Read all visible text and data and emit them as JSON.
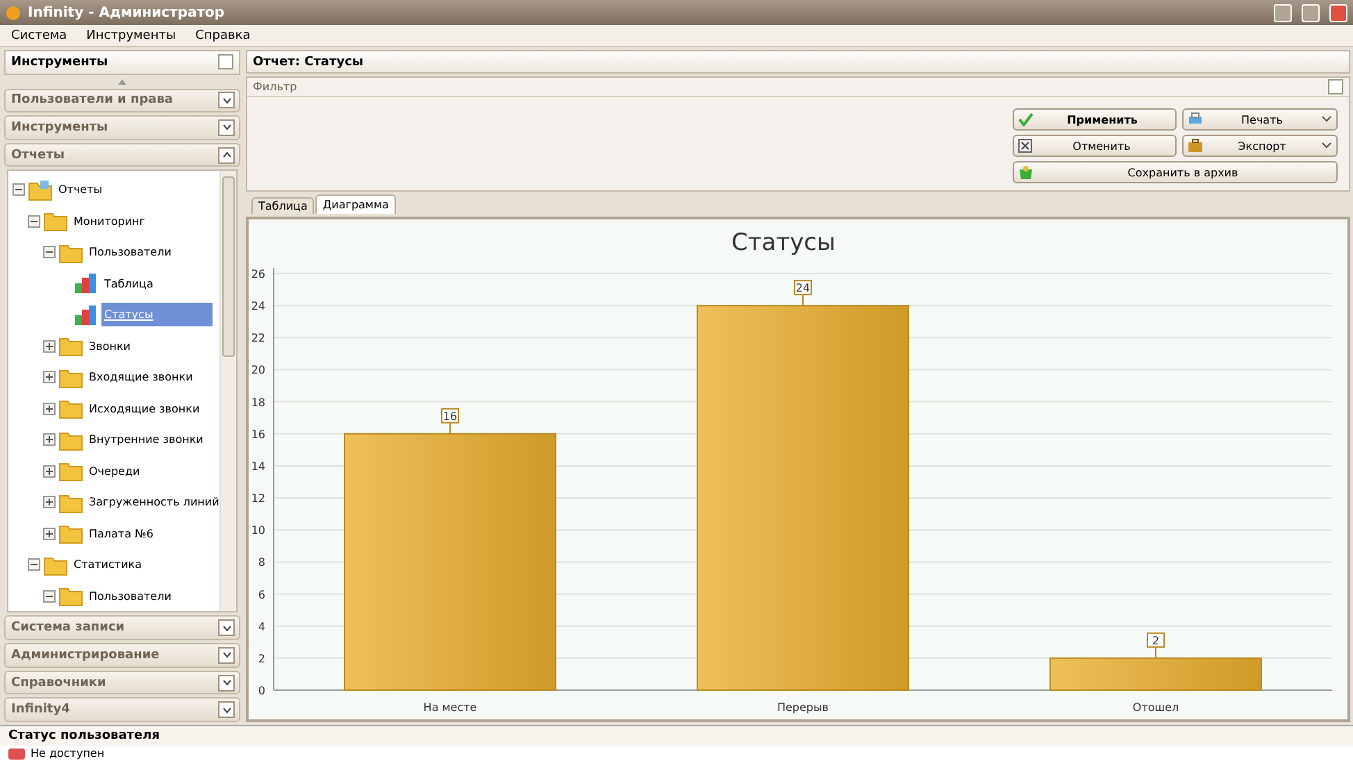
{
  "window": {
    "title": "Infinity - Администратор"
  },
  "menu": [
    "Система",
    "Инструменты",
    "Справка"
  ],
  "tools_panel": {
    "title": "Инструменты",
    "groups_top": [
      {
        "label": "Пользователи и права",
        "expanded": false
      },
      {
        "label": "Инструменты",
        "expanded": false
      },
      {
        "label": "Отчеты",
        "expanded": true
      }
    ],
    "tree": [
      {
        "label": "Отчеты",
        "kind": "root",
        "expanded": true,
        "selected": false,
        "children": [
          {
            "label": "Мониторинг",
            "kind": "folder",
            "expanded": true,
            "selected": false,
            "children": [
              {
                "label": "Пользователи",
                "kind": "folder",
                "expanded": true,
                "selected": false,
                "children": [
                  {
                    "label": "Таблица",
                    "kind": "report",
                    "selected": false
                  },
                  {
                    "label": "Статусы",
                    "kind": "report",
                    "selected": true
                  }
                ]
              },
              {
                "label": "Звонки",
                "kind": "folder",
                "expanded": false,
                "selected": false
              },
              {
                "label": "Входящие звонки",
                "kind": "folder",
                "expanded": false,
                "selected": false
              },
              {
                "label": "Исходящие звонки",
                "kind": "folder",
                "expanded": false,
                "selected": false
              },
              {
                "label": "Внутренние звонки",
                "kind": "folder",
                "expanded": false,
                "selected": false
              },
              {
                "label": "Очереди",
                "kind": "folder",
                "expanded": false,
                "selected": false
              },
              {
                "label": "Загруженность линий",
                "kind": "folder",
                "expanded": false,
                "selected": false
              },
              {
                "label": "Палата №6",
                "kind": "folder",
                "expanded": false,
                "selected": false
              }
            ]
          },
          {
            "label": "Статистика",
            "kind": "folder",
            "expanded": true,
            "selected": false,
            "children": [
              {
                "label": "Пользователи",
                "kind": "folder",
                "expanded": true,
                "selected": false
              }
            ]
          }
        ]
      }
    ],
    "groups_bottom": [
      {
        "label": "Система записи",
        "expanded": false
      },
      {
        "label": "Администрирование",
        "expanded": false
      },
      {
        "label": "Справочники",
        "expanded": false
      },
      {
        "label": "Infinity4",
        "expanded": false
      }
    ]
  },
  "report": {
    "title": "Отчет: Статусы",
    "filter_title": "Фильтр",
    "buttons": [
      {
        "label": "Применить",
        "kind": "apply"
      },
      {
        "label": "Печать",
        "kind": "print"
      },
      {
        "label": "Отменить",
        "kind": "cancel"
      },
      {
        "label": "Экспорт",
        "kind": "export"
      },
      {
        "label": "Сохранить в архив",
        "kind": "archive"
      }
    ],
    "tabs": [
      {
        "label": "Таблица",
        "selected": false
      },
      {
        "label": "Диаграмма",
        "selected": true
      }
    ],
    "chart_data": {
      "type": "bar",
      "title": "Статусы",
      "categories": [
        "На месте",
        "Перерыв",
        "Отошел"
      ],
      "values": [
        16,
        24,
        2
      ],
      "grid": true,
      "ylim": [
        0,
        26
      ],
      "yticks": [
        0,
        2,
        4,
        6,
        8,
        10,
        12,
        14,
        16,
        18,
        20,
        22,
        24,
        26
      ],
      "data_labels": true
    }
  },
  "status_panel": {
    "title": "Статус пользователя",
    "items": [
      {
        "label": "Не доступен",
        "color": "#e05050"
      }
    ]
  }
}
